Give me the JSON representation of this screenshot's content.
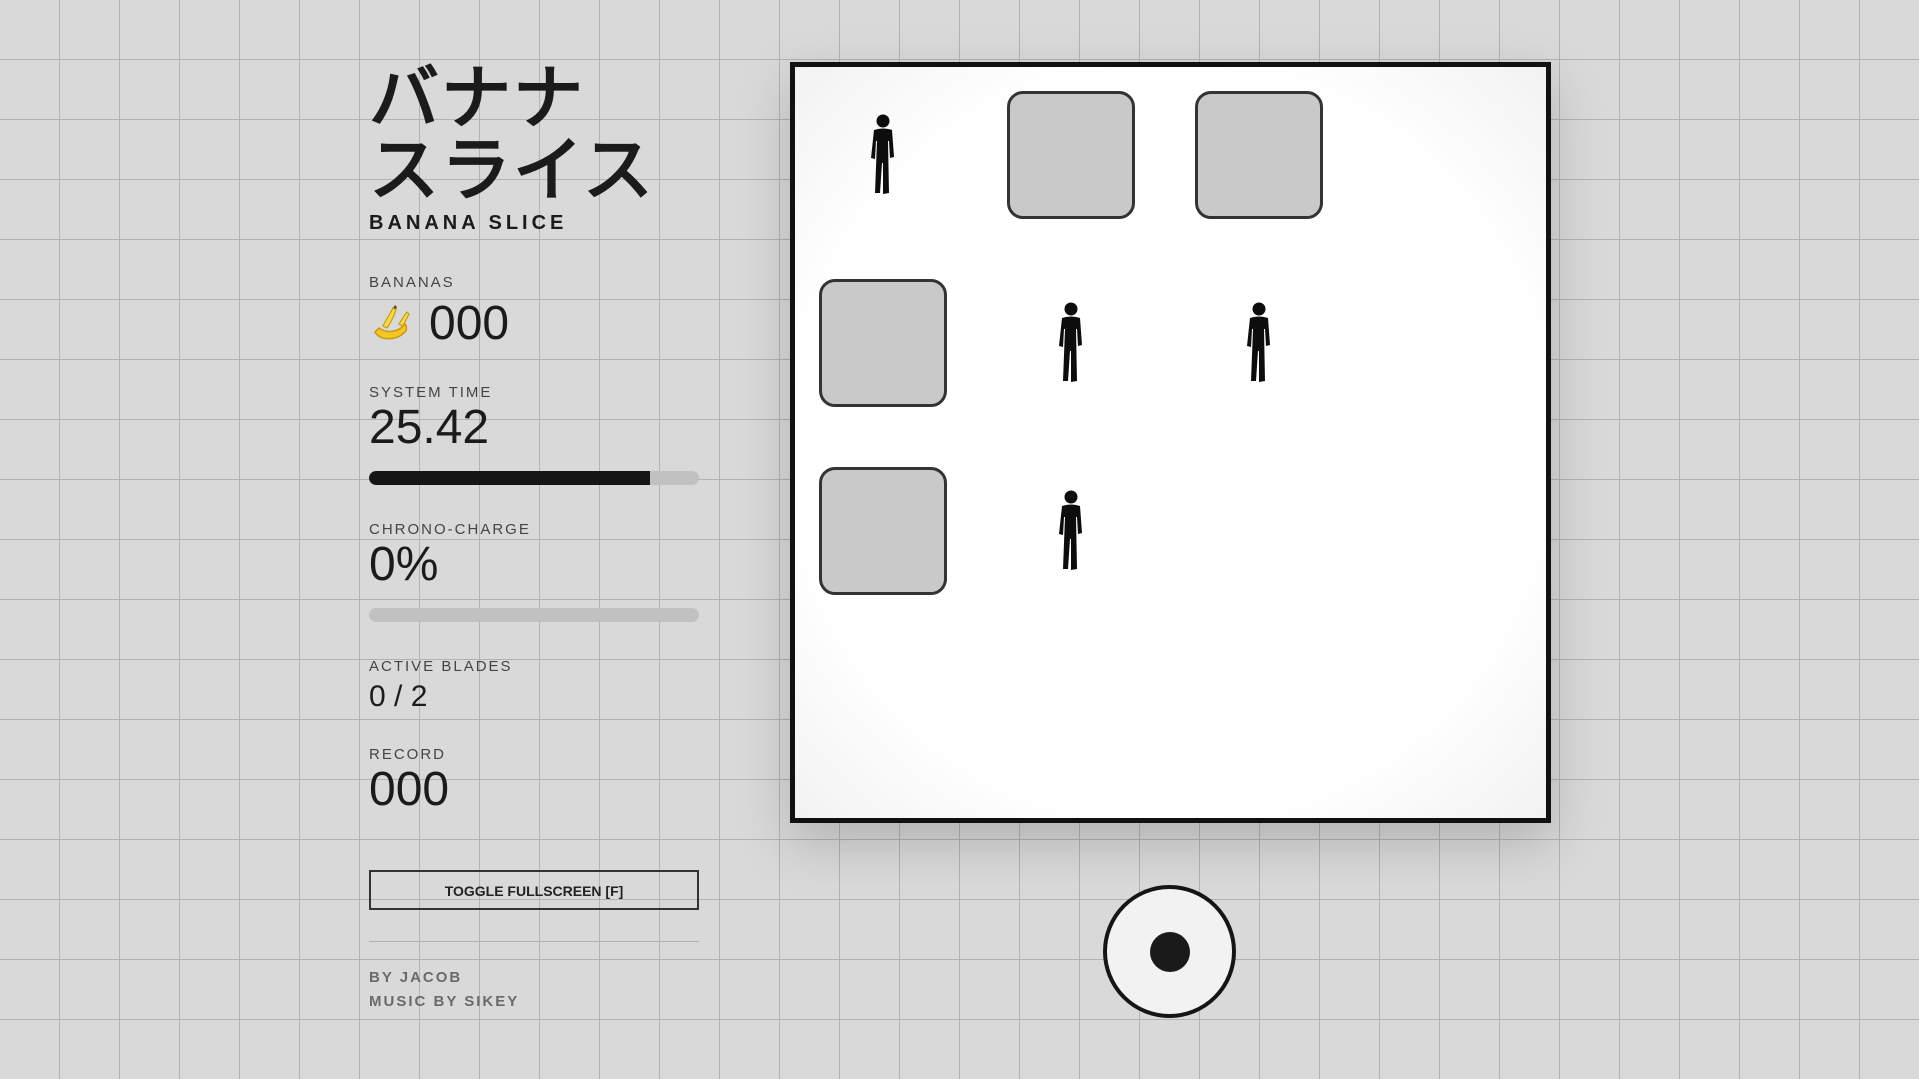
{
  "title": {
    "japanese": "バナナ\nスライス",
    "english": "BANANA SLICE"
  },
  "stats": {
    "bananas": {
      "label": "BANANAS",
      "value": "000",
      "icon": "banana-icon"
    },
    "system_time": {
      "label": "SYSTEM TIME",
      "value": "25.42",
      "progress": 0.85
    },
    "chrono_charge": {
      "label": "CHRONO-CHARGE",
      "value": "0%",
      "progress": 0
    },
    "active_blades": {
      "label": "ACTIVE BLADES",
      "value": "0 / 2"
    },
    "record": {
      "label": "RECORD",
      "value": "000"
    }
  },
  "controls": {
    "fullscreen_label": "TOGGLE FULLSCREEN [F]"
  },
  "credits": {
    "author": "BY JACOB",
    "music": "MUSIC BY SIKEY"
  },
  "board": {
    "grid_size": 4,
    "cells": [
      {
        "row": 0,
        "col": 0,
        "type": "person"
      },
      {
        "row": 0,
        "col": 1,
        "type": "empty"
      },
      {
        "row": 0,
        "col": 2,
        "type": "empty"
      },
      {
        "row": 1,
        "col": 0,
        "type": "empty"
      },
      {
        "row": 1,
        "col": 1,
        "type": "person"
      },
      {
        "row": 1,
        "col": 2,
        "type": "person"
      },
      {
        "row": 2,
        "col": 0,
        "type": "empty"
      },
      {
        "row": 2,
        "col": 1,
        "type": "person"
      }
    ]
  },
  "colors": {
    "background": "#d9d9d9",
    "ink": "#161616",
    "tile": "#c9c9c9",
    "board": "#ffffff"
  }
}
